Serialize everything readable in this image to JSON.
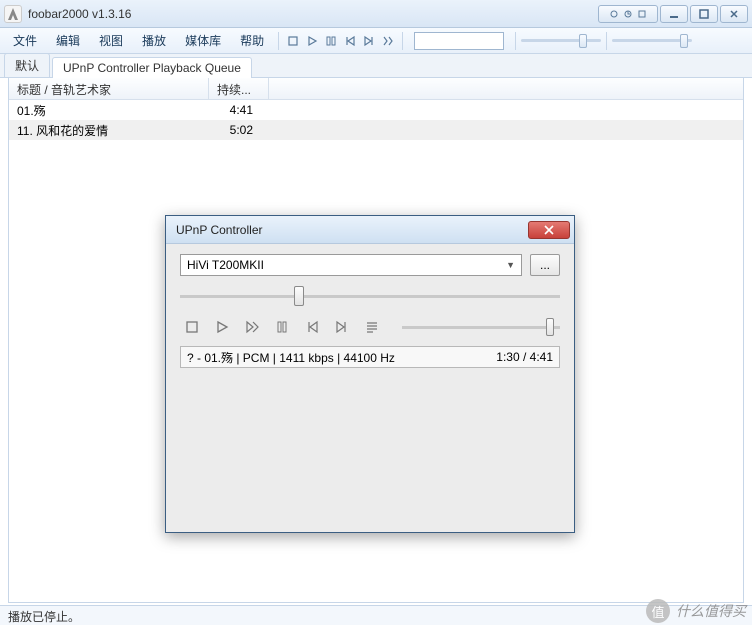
{
  "window": {
    "title": "foobar2000 v1.3.16"
  },
  "menu": {
    "file": "文件",
    "edit": "编辑",
    "view": "视图",
    "play": "播放",
    "library": "媒体库",
    "help": "帮助"
  },
  "tabs": {
    "default": "默认",
    "queue": "UPnP Controller Playback Queue"
  },
  "columns": {
    "title": "标题 / 音轨艺术家",
    "duration": "持续..."
  },
  "tracks": [
    {
      "title": "01.殇",
      "duration": "4:41"
    },
    {
      "title": "11. 风和花的爱情",
      "duration": "5:02"
    }
  ],
  "status": "播放已停止。",
  "dialog": {
    "title": "UPnP Controller",
    "device": "HiVi T200MKII",
    "more": "...",
    "nowplaying": "? - 01.殇 | PCM | 1411 kbps | 44100 Hz",
    "time": "1:30 / 4:41"
  },
  "watermark": {
    "badge": "值",
    "text": "什么值得买"
  }
}
